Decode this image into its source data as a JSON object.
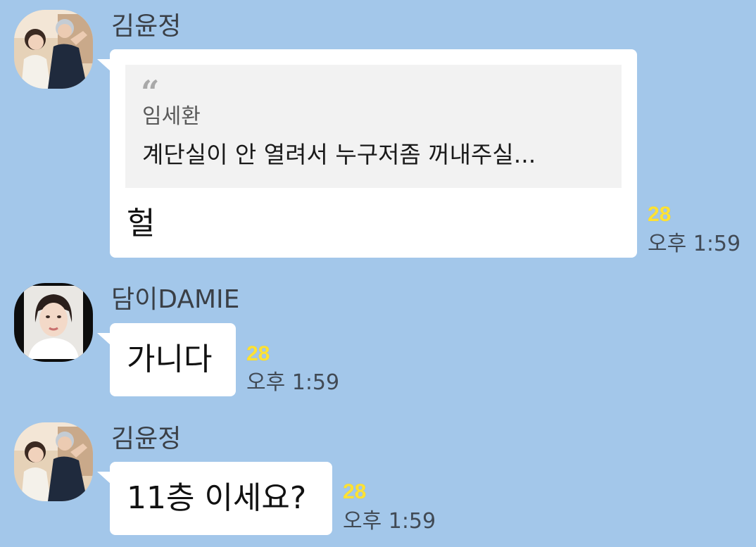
{
  "messages": [
    {
      "sender": "김윤정",
      "avatar": "profile-photo-two-people",
      "quote": {
        "icon": "quote-mark-icon",
        "mark": "“",
        "author": "임세환",
        "text": "계단실이 안 열려서 누구저좀 꺼내주실..."
      },
      "text": "헐",
      "unread_count": "28",
      "time": "오후 1:59"
    },
    {
      "sender": "담이DAMIE",
      "avatar": "profile-photo-woman",
      "text": "가니다",
      "unread_count": "28",
      "time": "오후 1:59"
    },
    {
      "sender": "김윤정",
      "avatar": "profile-photo-two-people",
      "text": "11층 이세요?",
      "unread_count": "28",
      "time": "오후 1:59"
    }
  ],
  "colors": {
    "background": "#a3c7ea",
    "bubble": "#ffffff",
    "unread": "#ffe234",
    "quote_box": "#f2f2f2"
  }
}
